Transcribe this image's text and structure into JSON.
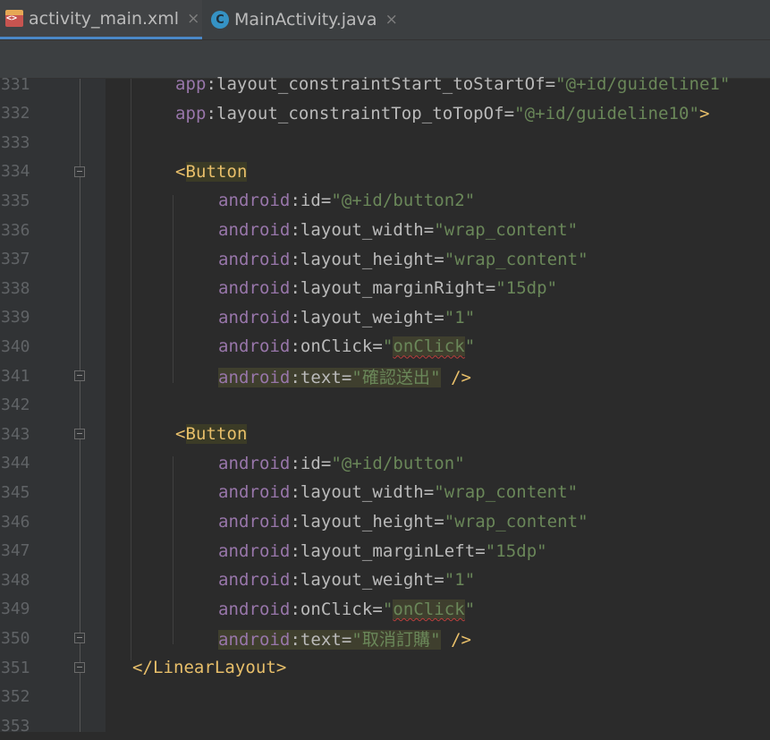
{
  "tabs": [
    {
      "label": "activity_main.xml",
      "icon": "xml-file-icon",
      "active": true
    },
    {
      "label": "MainActivity.java",
      "icon": "java-class-icon",
      "active": false
    }
  ],
  "java_icon_letter": "C",
  "close_glyph": "×",
  "lines": [
    {
      "num": "331",
      "indent": 2,
      "parts": [
        [
          "ns",
          "app"
        ],
        [
          "at",
          ":layout_constraintStart_toStartOf="
        ],
        [
          "val",
          "\"@+id/guideline1\""
        ]
      ]
    },
    {
      "num": "332",
      "indent": 2,
      "parts": [
        [
          "ns",
          "app"
        ],
        [
          "at",
          ":layout_constraintTop_toTopOf="
        ],
        [
          "val",
          "\"@+id/guideline10\""
        ],
        [
          "tag",
          ">"
        ]
      ]
    },
    {
      "num": "333",
      "indent": 0,
      "parts": []
    },
    {
      "num": "334",
      "indent": 2,
      "fold": true,
      "parts": [
        [
          "tag",
          "<"
        ],
        [
          "taghl",
          "Button"
        ]
      ]
    },
    {
      "num": "335",
      "indent": 3,
      "parts": [
        [
          "ns",
          "android"
        ],
        [
          "at",
          ":id="
        ],
        [
          "val",
          "\"@+id/button2\""
        ]
      ]
    },
    {
      "num": "336",
      "indent": 3,
      "parts": [
        [
          "ns",
          "android"
        ],
        [
          "at",
          ":layout_width="
        ],
        [
          "val",
          "\"wrap_content\""
        ]
      ]
    },
    {
      "num": "337",
      "indent": 3,
      "parts": [
        [
          "ns",
          "android"
        ],
        [
          "at",
          ":layout_height="
        ],
        [
          "val",
          "\"wrap_content\""
        ]
      ]
    },
    {
      "num": "338",
      "indent": 3,
      "parts": [
        [
          "ns",
          "android"
        ],
        [
          "at",
          ":layout_marginRight="
        ],
        [
          "val",
          "\"15dp\""
        ]
      ]
    },
    {
      "num": "339",
      "indent": 3,
      "parts": [
        [
          "ns",
          "android"
        ],
        [
          "at",
          ":layout_weight="
        ],
        [
          "val",
          "\"1\""
        ]
      ]
    },
    {
      "num": "340",
      "indent": 3,
      "parts": [
        [
          "ns",
          "android"
        ],
        [
          "at",
          ":onClick="
        ],
        [
          "val",
          "\""
        ],
        [
          "valsq",
          "onClick"
        ],
        [
          "val",
          "\""
        ]
      ]
    },
    {
      "num": "341",
      "indent": 3,
      "fold": true,
      "parts": [
        [
          "nshl",
          "android"
        ],
        [
          "athl",
          ":text="
        ],
        [
          "valhl",
          "\"確認送出\""
        ],
        [
          "at",
          " "
        ],
        [
          "tag",
          "/>"
        ]
      ]
    },
    {
      "num": "342",
      "indent": 0,
      "parts": []
    },
    {
      "num": "343",
      "indent": 2,
      "fold": true,
      "parts": [
        [
          "tag",
          "<"
        ],
        [
          "taghl",
          "Button"
        ]
      ]
    },
    {
      "num": "344",
      "indent": 3,
      "parts": [
        [
          "ns",
          "android"
        ],
        [
          "at",
          ":id="
        ],
        [
          "val",
          "\"@+id/button\""
        ]
      ]
    },
    {
      "num": "345",
      "indent": 3,
      "parts": [
        [
          "ns",
          "android"
        ],
        [
          "at",
          ":layout_width="
        ],
        [
          "val",
          "\"wrap_content\""
        ]
      ]
    },
    {
      "num": "346",
      "indent": 3,
      "parts": [
        [
          "ns",
          "android"
        ],
        [
          "at",
          ":layout_height="
        ],
        [
          "val",
          "\"wrap_content\""
        ]
      ]
    },
    {
      "num": "347",
      "indent": 3,
      "parts": [
        [
          "ns",
          "android"
        ],
        [
          "at",
          ":layout_marginLeft="
        ],
        [
          "val",
          "\"15dp\""
        ]
      ]
    },
    {
      "num": "348",
      "indent": 3,
      "parts": [
        [
          "ns",
          "android"
        ],
        [
          "at",
          ":layout_weight="
        ],
        [
          "val",
          "\"1\""
        ]
      ]
    },
    {
      "num": "349",
      "indent": 3,
      "parts": [
        [
          "ns",
          "android"
        ],
        [
          "at",
          ":onClick="
        ],
        [
          "val",
          "\""
        ],
        [
          "valsq",
          "onClick"
        ],
        [
          "val",
          "\""
        ]
      ]
    },
    {
      "num": "350",
      "indent": 3,
      "fold": true,
      "parts": [
        [
          "nshl",
          "android"
        ],
        [
          "athl",
          ":text="
        ],
        [
          "valhl",
          "\"取消訂購\""
        ],
        [
          "at",
          " "
        ],
        [
          "tag",
          "/>"
        ]
      ]
    },
    {
      "num": "351",
      "indent": 1,
      "fold": true,
      "parts": [
        [
          "tag",
          "</LinearLayout>"
        ]
      ]
    },
    {
      "num": "352",
      "indent": 0,
      "parts": []
    },
    {
      "num": "353",
      "indent": 0,
      "parts": []
    }
  ]
}
